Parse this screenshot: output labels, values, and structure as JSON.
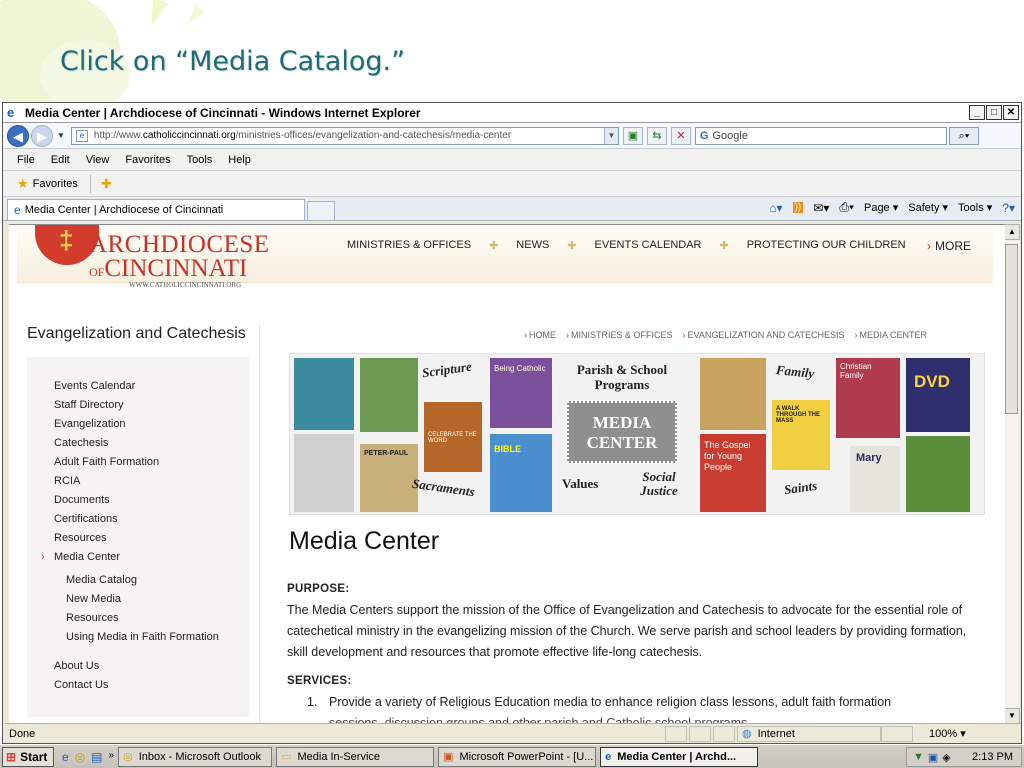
{
  "slide": {
    "instruction": "Click on “Media Catalog.”"
  },
  "window": {
    "title": "Media Center | Archdiocese of Cincinnati - Windows Internet Explorer",
    "url_prefix": "http://www.",
    "url_domain": "catholiccincinnati.org",
    "url_path": "/ministries-offices/evangelization-and-catechesis/media-center",
    "search_engine": "Google"
  },
  "menu": [
    "File",
    "Edit",
    "View",
    "Favorites",
    "Tools",
    "Help"
  ],
  "favorites_label": "Favorites",
  "tab_label": "Media Center | Archdiocese of Cincinnati",
  "commands": {
    "page": "Page",
    "safety": "Safety",
    "tools": "Tools"
  },
  "site": {
    "logo_line1": "ARCHDIOCESE",
    "logo_of": "OF",
    "logo_line2": "CINCINNATI",
    "logo_url": "WWW.CATHOLICCINCINNATI.ORG",
    "nav": [
      "MINISTRIES & OFFICES",
      "NEWS",
      "EVENTS CALENDAR",
      "PROTECTING OUR CHILDREN"
    ],
    "more": "MORE"
  },
  "sidebar": {
    "title": "Evangelization and Catechesis",
    "items": [
      "Events Calendar",
      "Staff Directory",
      "Evangelization",
      "Catechesis",
      "Adult Faith Formation",
      "RCIA",
      "Documents",
      "Certifications",
      "Resources",
      "Media Center"
    ],
    "subitems": [
      "Media Catalog",
      "New Media",
      "Resources",
      "Using Media in Faith Formation"
    ],
    "bottom_items": [
      "About Us",
      "Contact Us"
    ]
  },
  "breadcrumb": [
    "HOME",
    "MINISTRIES & OFFICES",
    "EVANGELIZATION AND CATECHESIS",
    "MEDIA CENTER"
  ],
  "banner": {
    "scripture": "Scripture",
    "parish_programs": "Parish & School Programs",
    "media_center_line1": "MEDIA",
    "media_center_line2": "CENTER",
    "family": "Family",
    "sacraments": "Sacraments",
    "values": "Values",
    "social_justice": "Social Justice",
    "saints": "Saints",
    "dvd": "DVD",
    "mary": "Mary",
    "peter_paul": "PETER-PAUL",
    "gospel": "The Gospel for Young People",
    "walk": "A WALK THROUGH THE MASS",
    "bible": "BIBLE",
    "christian_family": "Christian Family",
    "celebrate": "CELEBRATE THE WORD",
    "being_catholic": "Being Catholic"
  },
  "content": {
    "title": "Media Center",
    "purpose_heading": "PURPOSE:",
    "purpose_text": "The Media Centers support the mission of the Office of Evangelization and Catechesis to advocate for the essential role of catechetical ministry in the evangelizing mission of the Church.  We serve parish and school leaders by providing formation, skill development and resources that promote effective life-long catechesis.",
    "services_heading": "SERVICES:",
    "service_1_num": "1.",
    "service_1": "Provide a variety of Religious Education media to enhance religion class lessons, adult faith formation",
    "service_1_cont": "sessions, discussion groups and other parish and Catholic school programs."
  },
  "status": {
    "done": "Done",
    "zone": "Internet",
    "zoom": "100%"
  },
  "taskbar": {
    "start": "Start",
    "tasks": [
      "Inbox - Microsoft Outlook",
      "Media In-Service",
      "Microsoft PowerPoint - [U...",
      "Media Center | Archd..."
    ],
    "clock": "2:13 PM"
  }
}
